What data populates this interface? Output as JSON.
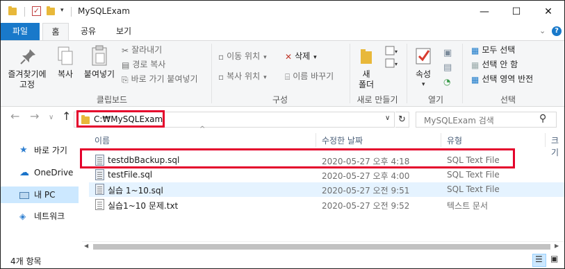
{
  "window": {
    "title": "MySQLExam",
    "minimize_glyph": "—",
    "maximize_glyph": "☐",
    "close_glyph": "✕"
  },
  "ribbon_tabs": {
    "file": "파일",
    "home": "홈",
    "share": "공유",
    "view": "보기",
    "collapse_glyph": "⌄",
    "help_glyph": "?"
  },
  "ribbon": {
    "clipboard": {
      "pin_label_line1": "즐겨찾기에",
      "pin_label_line2": "고정",
      "copy_label": "복사",
      "paste_label": "붙여넣기",
      "cut_label": "잘라내기",
      "copy_path_label": "경로 복사",
      "paste_shortcut_label": "바로 가기 붙여넣기",
      "group_label": "클립보드"
    },
    "organize": {
      "move_to_label": "이동 위치",
      "copy_to_label": "복사 위치",
      "delete_label": "삭제",
      "rename_label": "이름 바꾸기",
      "group_label": "구성"
    },
    "new": {
      "new_folder_line1": "새",
      "new_folder_line2": "폴더",
      "group_label": "새로 만들기"
    },
    "open": {
      "properties_label": "속성",
      "group_label": "열기"
    },
    "select": {
      "select_all_label": "모두 선택",
      "select_none_label": "선택 안 함",
      "invert_selection_label": "선택 영역 반전",
      "group_label": "선택"
    }
  },
  "address_bar": {
    "path": "C:₩MySQLExam",
    "search_placeholder": "MySQLExam 검색"
  },
  "nav_pane": {
    "items": [
      {
        "label": "바로 가기",
        "icon": "star-icon"
      },
      {
        "label": "OneDrive",
        "icon": "cloud-icon"
      },
      {
        "label": "내 PC",
        "icon": "pc-icon"
      },
      {
        "label": "네트워크",
        "icon": "network-icon"
      }
    ]
  },
  "file_list": {
    "columns": [
      "이름",
      "수정한 날짜",
      "유형",
      "크기"
    ],
    "rows": [
      {
        "name": "testdbBackup.sql",
        "date": "2020-05-27 오후 4:18",
        "type": "SQL Text File"
      },
      {
        "name": "testFile.sql",
        "date": "2020-05-27 오후 4:00",
        "type": "SQL Text File"
      },
      {
        "name": "실습 1~10.sql",
        "date": "2020-05-27 오전 9:51",
        "type": "SQL Text File"
      },
      {
        "name": "실습1~10 문제.txt",
        "date": "2020-05-27 오전 9:52",
        "type": "텍스트 문서"
      }
    ]
  },
  "status_bar": {
    "item_count": "4개 항목"
  },
  "colors": {
    "accent": "#1979ca",
    "highlight_box": "#e4002b",
    "selection": "#cce8ff",
    "hover_row": "#e5f3ff",
    "folder": "#e8b83a"
  }
}
